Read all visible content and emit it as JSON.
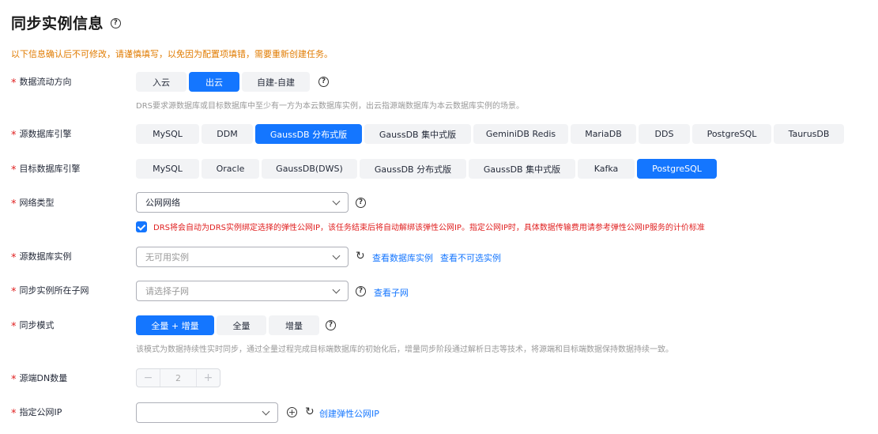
{
  "header": {
    "title": "同步实例信息",
    "help_icon": "help-circle-icon"
  },
  "warning": "以下信息确认后不可修改，请谨慎填写，以免因为配置项填错，需要重新创建任务。",
  "flow_direction": {
    "label": "数据流动方向",
    "options": [
      "入云",
      "出云",
      "自建-自建"
    ],
    "selected": "出云",
    "hint": "DRS要求源数据库或目标数据库中至少有一方为本云数据库实例，出云指源端数据库为本云数据库实例的场景。"
  },
  "source_engine": {
    "label": "源数据库引擎",
    "options": [
      "MySQL",
      "DDM",
      "GaussDB 分布式版",
      "GaussDB 集中式版",
      "GeminiDB Redis",
      "MariaDB",
      "DDS",
      "PostgreSQL",
      "TaurusDB"
    ],
    "selected": "GaussDB 分布式版"
  },
  "target_engine": {
    "label": "目标数据库引擎",
    "options": [
      "MySQL",
      "Oracle",
      "GaussDB(DWS)",
      "GaussDB 分布式版",
      "GaussDB 集中式版",
      "Kafka",
      "PostgreSQL"
    ],
    "selected": "PostgreSQL"
  },
  "network_type": {
    "label": "网络类型",
    "value": "公网网络",
    "checkbox_text": "DRS将会自动为DRS实例绑定选择的弹性公网IP，该任务结束后将自动解绑该弹性公网IP。指定公网IP时，具体数据传输费用请参考弹性公网IP服务的计价标准"
  },
  "source_instance": {
    "label": "源数据库实例",
    "placeholder": "无可用实例",
    "link_view": "查看数据库实例",
    "link_unselectable": "查看不可选实例"
  },
  "subnet": {
    "label": "同步实例所在子网",
    "placeholder": "请选择子网",
    "link": "查看子网"
  },
  "sync_mode": {
    "label": "同步模式",
    "options": [
      "全量 + 增量",
      "全量",
      "增量"
    ],
    "selected": "全量 + 增量",
    "hint": "该模式为数据持续性实时同步，通过全量过程完成目标端数据库的初始化后，增量同步阶段通过解析日志等技术，将源端和目标端数据保持数据持续一致。"
  },
  "dn_count": {
    "label": "源端DN数量",
    "value": "2",
    "minus": "−",
    "plus": "+"
  },
  "public_ip": {
    "label": "指定公网IP",
    "link": "创建弹性公网IP"
  },
  "colors": {
    "primary": "#1476ff",
    "warning": "#e07b00",
    "danger": "#e02020"
  }
}
